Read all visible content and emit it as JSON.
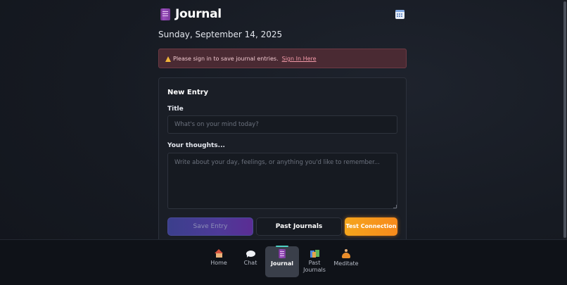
{
  "header": {
    "title": "Journal",
    "logo_icon": "book-icon",
    "calendar_icon": "calendar-icon"
  },
  "date": "Sunday, September 14, 2025",
  "alert": {
    "icon": "warning-icon",
    "message": "Please sign in to save journal entries.",
    "link_label": "Sign In Here"
  },
  "entry_form": {
    "heading": "New Entry",
    "title_label": "Title",
    "title_placeholder": "What's on your mind today?",
    "title_value": "",
    "thoughts_label": "Your thoughts...",
    "thoughts_placeholder": "Write about your day, feelings, or anything you'd like to remember...",
    "thoughts_value": "",
    "save_label": "Save Entry",
    "past_label": "Past Journals",
    "test_label": "Test Connection"
  },
  "nav": {
    "items": [
      {
        "label": "Home",
        "icon": "house-icon"
      },
      {
        "label": "Chat",
        "icon": "speech-bubble-icon"
      },
      {
        "label": "Journal",
        "icon": "notebook-icon",
        "active": true
      },
      {
        "label": "Past Journals",
        "icon": "books-icon"
      },
      {
        "label": "Meditate",
        "icon": "meditation-icon"
      }
    ]
  },
  "colors": {
    "accent_teal": "#4fd1c5",
    "alert_bg": "#4a2a33",
    "save_gradient_start": "#3b3f8c",
    "save_gradient_end": "#5b2d94",
    "test_gradient_start": "#f5a51c",
    "test_gradient_end": "#f78a1c"
  }
}
